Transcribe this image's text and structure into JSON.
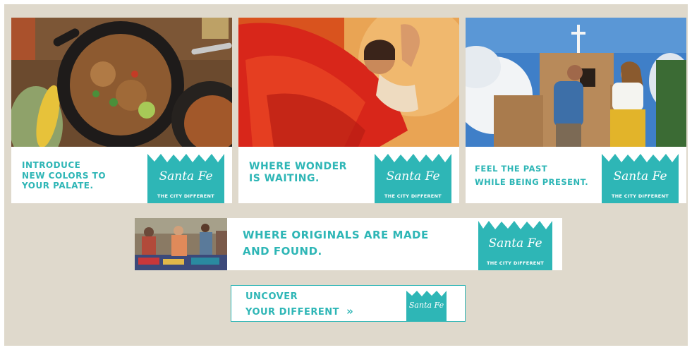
{
  "ads": [
    {
      "id": "food",
      "headline_lines": [
        "INTRODUCE",
        "NEW COLORS TO",
        "YOUR PALATE."
      ],
      "logo_script": "Santa Fe",
      "logo_tag": "THE CITY DIFFERENT"
    },
    {
      "id": "dancer",
      "headline_lines": [
        "WHERE WONDER",
        "IS WAITING."
      ],
      "logo_script": "Santa Fe",
      "logo_tag": "THE CITY DIFFERENT"
    },
    {
      "id": "mission",
      "headline_lines": [
        "FEEL THE PAST",
        "WHILE BEING PRESENT."
      ],
      "logo_script": "Santa Fe",
      "logo_tag": "THE CITY DIFFERENT"
    },
    {
      "id": "market",
      "headline_lines": [
        "WHERE ORIGINALS ARE MADE",
        "AND FOUND."
      ],
      "logo_script": "Santa Fe",
      "logo_tag": "THE CITY DIFFERENT"
    },
    {
      "id": "uncover",
      "headline_lines": [
        "UNCOVER",
        "YOUR DIFFERENT"
      ],
      "cta_glyph": "»",
      "logo_script": "Santa Fe"
    }
  ],
  "colors": {
    "brand_teal": "#2eb6b6",
    "background": "#dfd9cc",
    "card": "#ffffff"
  }
}
